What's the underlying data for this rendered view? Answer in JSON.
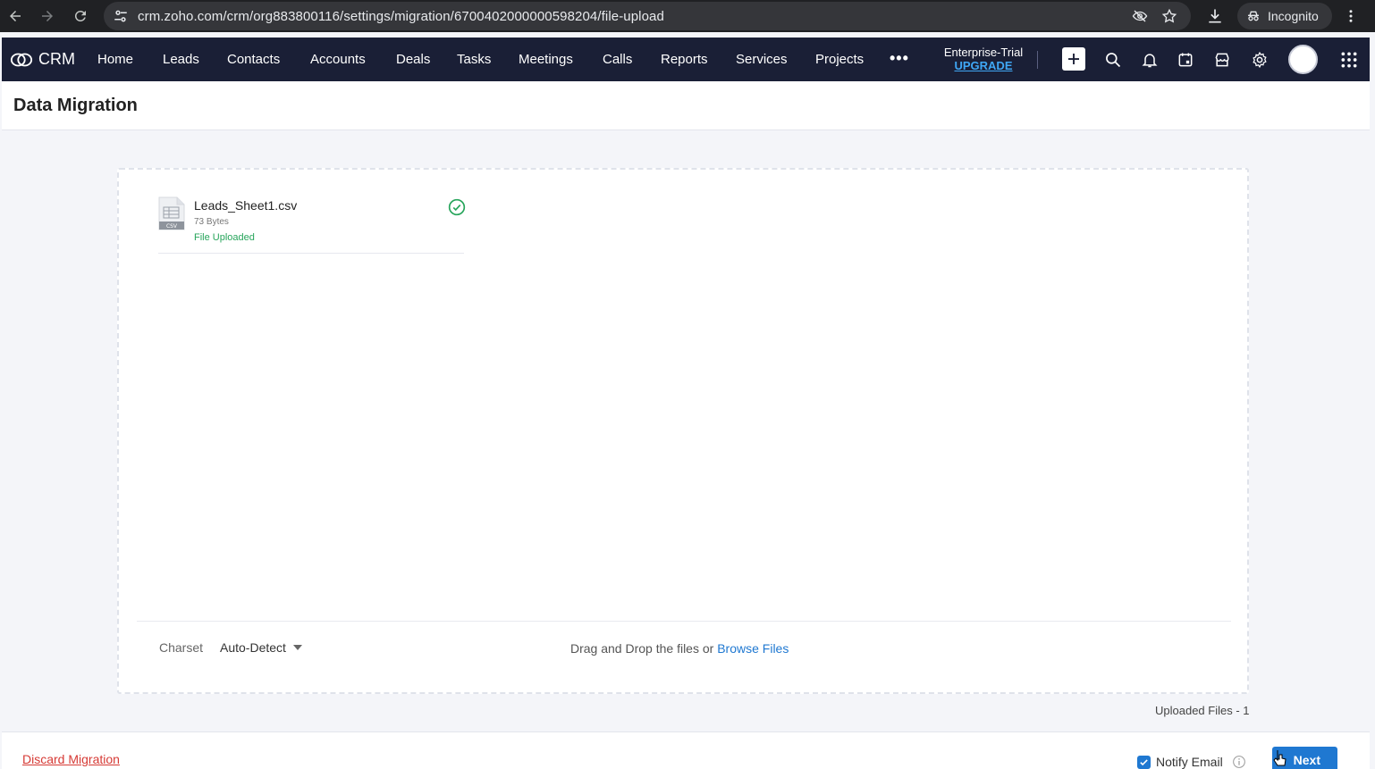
{
  "browser": {
    "url": "crm.zoho.com/crm/org883800116/settings/migration/6700402000000598204/file-upload",
    "incognito_label": "Incognito"
  },
  "crm_nav": {
    "logo_text": "CRM",
    "items": [
      "Home",
      "Leads",
      "Contacts",
      "Accounts",
      "Deals",
      "Tasks",
      "Meetings",
      "Calls",
      "Reports",
      "Services",
      "Projects"
    ],
    "more_label": "•••",
    "plan_name": "Enterprise-Trial",
    "upgrade_label": "UPGRADE"
  },
  "page": {
    "title": "Data Migration"
  },
  "upload": {
    "file": {
      "name": "Leads_Sheet1.csv",
      "size": "73 Bytes",
      "status": "File Uploaded",
      "icon_badge": "CSV"
    },
    "charset_label": "Charset",
    "charset_value": "Auto-Detect",
    "drop_hint": "Drag and Drop the files or",
    "browse_label": "Browse Files",
    "uploaded_count": "Uploaded Files - 1"
  },
  "footer": {
    "discard_label": "Discard Migration",
    "notify_label": "Notify Email",
    "notify_checked": true,
    "next_label": "Next"
  },
  "colors": {
    "nav_bg": "#1a1f36",
    "accent": "#1f78d1",
    "success": "#27a55b",
    "danger": "#d63a35",
    "upgrade": "#3fa7f5"
  }
}
